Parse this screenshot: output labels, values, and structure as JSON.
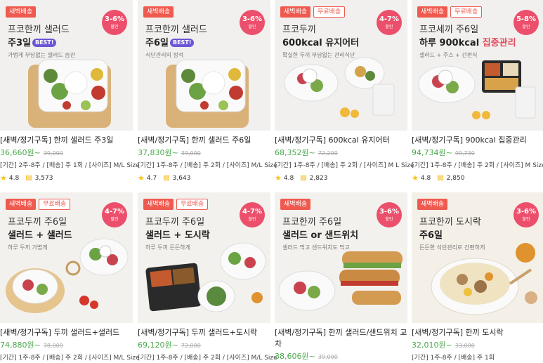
{
  "colors": {
    "accent": "#ef5a4f",
    "discount": "#ec4f6b",
    "price": "#4aa84b",
    "best": "#6c57d6"
  },
  "icons": {
    "rating": "star-icon",
    "review": "speech-bubble-icon"
  },
  "products": [
    {
      "badges": [
        "새벽배송"
      ],
      "discount": "3-6%",
      "discount_label": "할인",
      "line1": "프코한끼 샐러드",
      "line2": "주3일",
      "line2_hl": "",
      "best": "BEST!",
      "sub": "가볍게 부담없는 샐러드 습관",
      "title": "[새벽/정기구독] 한끼 샐러드 주3일",
      "price": "36,660원~",
      "orig_price": "39,000",
      "spec": "[기간] 2주-8주 / [배송] 주 1회 / [사이즈] M/L Size",
      "rating": "4.8",
      "reviews": "3,573"
    },
    {
      "badges": [
        "새벽배송"
      ],
      "discount": "3-6%",
      "discount_label": "할인",
      "line1": "프코한끼 샐러드",
      "line2": "주6일",
      "line2_hl": "",
      "best": "BEST!",
      "sub": "식단관리의 정석",
      "title": "[새벽/정기구독] 한끼 샐러드 주6일",
      "price": "37,830원~",
      "orig_price": "39,000",
      "spec": "[기간] 1주-8주 / [배송] 주 2회 / [사이즈] M/L Size",
      "rating": "4.7",
      "reviews": "3,643"
    },
    {
      "badges": [
        "새벽배송",
        "무료배송"
      ],
      "discount": "4-7%",
      "discount_label": "할인",
      "line1": "프코두끼",
      "line2": "600kcal 유지어터",
      "line2_hl": "",
      "best": "",
      "sub": "확실한 두끼 부담없는 관리식단",
      "title": "[새벽/정기구독] 600kcal 유지어터",
      "price": "68,352원~",
      "orig_price": "72,200",
      "spec": "[기간] 1주-8주 / [배송] 주 2회 / [사이즈] M L Size",
      "rating": "4.8",
      "reviews": "2,823"
    },
    {
      "badges": [
        "새벽배송",
        "무료배송"
      ],
      "discount": "5-8%",
      "discount_label": "할인",
      "line1": "프코세끼 주6일",
      "line2": "하루 900kcal ",
      "line2_hl": "집중관리",
      "best": "",
      "sub": "샐러드 + 주스 + 간편식",
      "title": "[새벽/정기구독] 900kcal 집중관리",
      "price": "94,734원~",
      "orig_price": "99,730",
      "spec": "[기간] 1주-8주 / [배송] 주 2회 / [사이즈] M Size",
      "rating": "4.8",
      "reviews": "2,850"
    },
    {
      "badges": [
        "새벽배송",
        "무료배송"
      ],
      "discount": "4-7%",
      "discount_label": "할인",
      "line1": "프코두끼 주6일",
      "line2": "샐러드 + 샐러드",
      "line2_hl": "",
      "best": "",
      "sub": "하루 두끼 가볍게",
      "title": "[새벽/정기구독] 두끼 샐러드+샐러드",
      "price": "74,880원~",
      "orig_price": "78,000",
      "spec": "[기간] 1주-8주 / [배송] 주 2회 / [사이즈] M/L Size"
    },
    {
      "badges": [
        "새벽배송",
        "무료배송"
      ],
      "discount": "4-7%",
      "discount_label": "할인",
      "line1": "프코두끼 주6일",
      "line2": "샐러드 + 도시락",
      "line2_hl": "",
      "best": "",
      "sub": "하루 두끼 든든하게",
      "title": "[새벽/정기구독] 두끼 샐러드+도시락",
      "price": "69,120원~",
      "orig_price": "72,000",
      "spec": "[기간] 1주-8주 / [배송] 주 2회 / [사이즈] M/L Size"
    },
    {
      "badges": [
        "새벽배송"
      ],
      "discount": "3-6%",
      "discount_label": "할인",
      "line1": "프코한끼 주6일",
      "line2": "샐러드 or 샌드위치",
      "line2_hl": "",
      "best": "",
      "sub": "샐러드 먹고 샌드위치도 먹고",
      "title": "[새벽/정기구독] 한끼 샐러드/샌드위치 교차",
      "price": "38,606원~",
      "orig_price": "39,000",
      "spec": ""
    },
    {
      "badges": [
        "새벽배송"
      ],
      "discount": "3-6%",
      "discount_label": "할인",
      "line1": "프코한끼 도시락",
      "line2": "주6일",
      "line2_hl": "",
      "best": "",
      "sub": "든든한 식단관리로 간편하게",
      "title": "[새벽/정기구독] 한끼 도시락",
      "price": "32,010원~",
      "orig_price": "33,000",
      "spec": "[기간] 1주-8주 / [배송] 주 1회"
    }
  ]
}
